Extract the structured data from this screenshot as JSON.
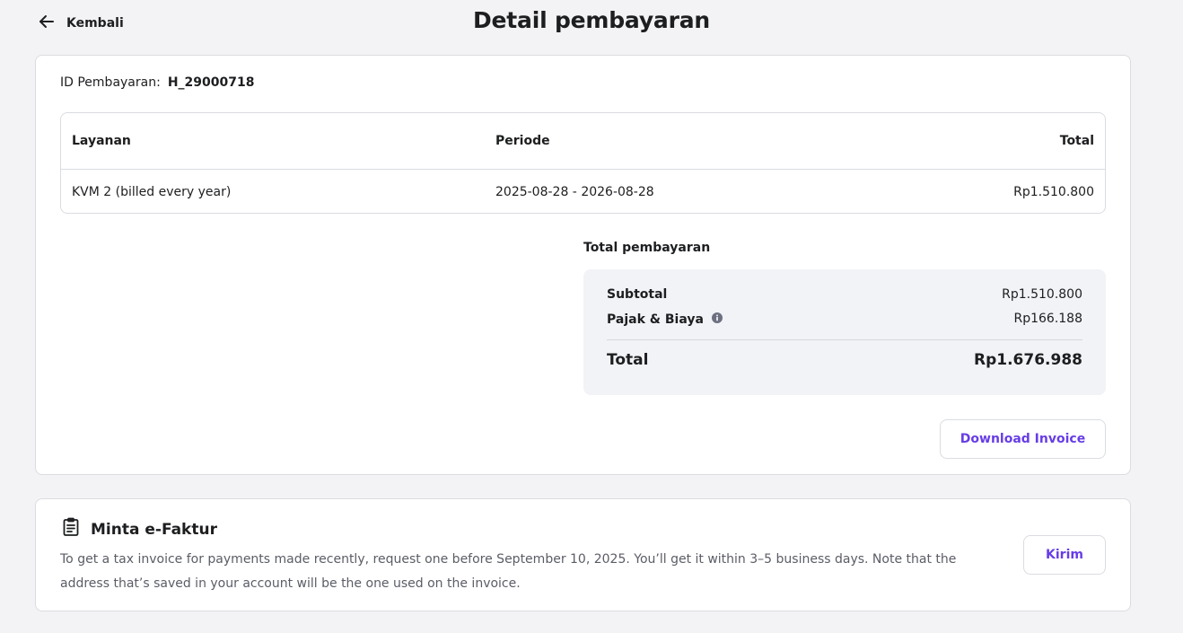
{
  "header": {
    "back_label": "Kembali",
    "title": "Detail pembayaran"
  },
  "payment": {
    "id_label": "ID Pembayaran:",
    "id_value": "H_29000718"
  },
  "table": {
    "columns": [
      "Layanan",
      "Periode",
      "Total"
    ],
    "rows": [
      [
        "KVM 2 (billed every year)",
        "2025-08-28 - 2026-08-28",
        "Rp1.510.800"
      ]
    ]
  },
  "summary": {
    "label": "Total pembayaran",
    "subtotal_label": "Subtotal",
    "subtotal_value": "Rp1.510.800",
    "tax_label": "Pajak & Biaya",
    "tax_value": "Rp166.188",
    "total_label": "Total",
    "total_value": "Rp1.676.988"
  },
  "download_label": "Download Invoice",
  "faktur": {
    "title": "Minta e-Faktur",
    "description": "To get a tax invoice for payments made recently, request one before September 10, 2025. You’ll get it within 3–5 business days. Note that the address that’s saved in your account will be the one used on the invoice.",
    "button_label": "Kirim"
  },
  "colors": {
    "accent": "#673de6",
    "background": "#f3f3f6",
    "summary_bg": "#f2f3f6"
  }
}
